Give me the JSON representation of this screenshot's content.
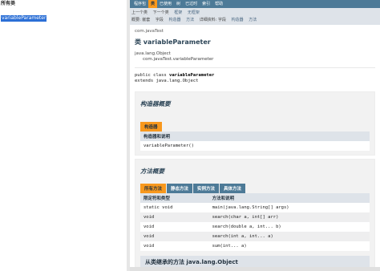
{
  "left": {
    "title": "所有类",
    "selected_item": "variableParameter"
  },
  "topnav": {
    "items": [
      "程序包",
      "类",
      "已使用",
      "树",
      "已过时",
      "索引",
      "帮助"
    ],
    "active": 1
  },
  "subnav": {
    "row1": [
      "上一个类",
      "下一个类",
      "框架",
      "无框架"
    ],
    "row2": [
      "概要: 嵌套",
      "字段",
      "构造器",
      "方法",
      "详细资料: 字段",
      "构造器",
      "方法"
    ]
  },
  "class_info": {
    "package": "com.javaTest",
    "title": "类 variableParameter",
    "inheritance": [
      "java.lang.Object",
      "com.javaTest.variableParameter"
    ],
    "decl_line1_prefix": "public class ",
    "decl_line1_name": "variableParameter",
    "decl_line2": "extends java.lang.Object"
  },
  "constructor_summary": {
    "heading": "构造器概要",
    "tab": "构造器",
    "column": "构造器和说明",
    "rows": [
      "variableParameter()"
    ]
  },
  "method_summary": {
    "heading": "方法概要",
    "tabs": [
      "所有方法",
      "静态方法",
      "实例方法",
      "具体方法"
    ],
    "columns": [
      "限定符和类型",
      "方法和说明"
    ],
    "rows": [
      {
        "modifier": "static void",
        "method": "main(java.lang.String[] args)"
      },
      {
        "modifier": "void",
        "method": "search(char a, int[] arr)"
      },
      {
        "modifier": "void",
        "method": "search(double a, int... b)"
      },
      {
        "modifier": "void",
        "method": "search(int a, int... a)"
      },
      {
        "modifier": "void",
        "method": "sum(int... a)"
      }
    ]
  },
  "inherited": {
    "label": "从类继承的方法 java.lang.Object"
  }
}
